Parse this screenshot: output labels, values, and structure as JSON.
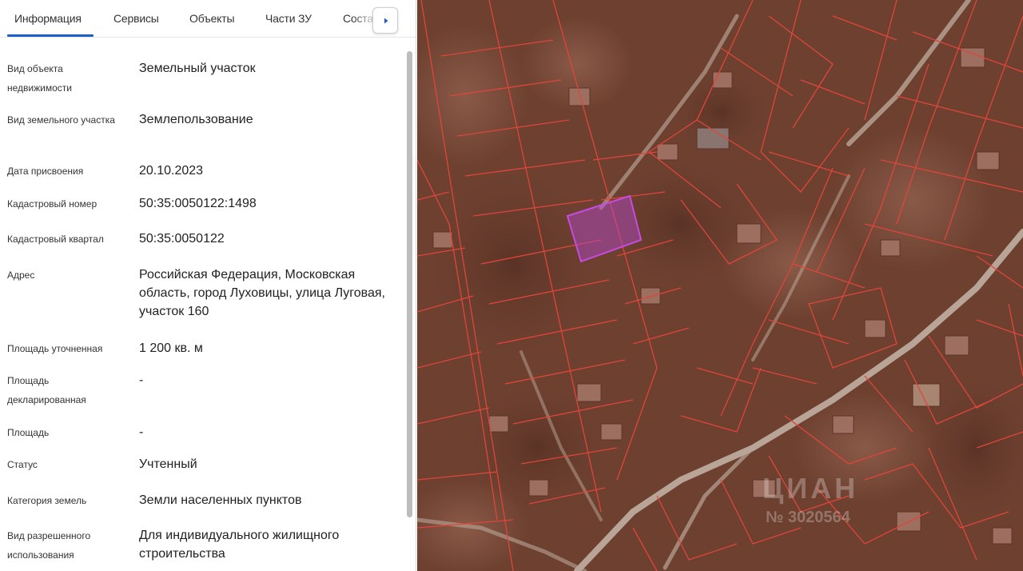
{
  "tabs": [
    {
      "label": "Информация",
      "active": true
    },
    {
      "label": "Сервисы",
      "active": false
    },
    {
      "label": "Объекты",
      "active": false
    },
    {
      "label": "Части ЗУ",
      "active": false
    },
    {
      "label": "Соста",
      "active": false
    }
  ],
  "fields": [
    {
      "label": "Вид объекта недвижимости",
      "value": "Земельный участок"
    },
    {
      "label": "Вид земельного участка",
      "value": "Землепользование"
    },
    {
      "label": "Дата присвоения",
      "value": "20.10.2023"
    },
    {
      "label": "Кадастровый номер",
      "value": "50:35:0050122:1498"
    },
    {
      "label": "Кадастровый квартал",
      "value": "50:35:0050122"
    },
    {
      "label": "Адрес",
      "value": "Российская Федерация, Московская область, город Луховицы, улица Луговая, участок 160"
    },
    {
      "label": "Площадь уточненная",
      "value": "1 200 кв. м"
    },
    {
      "label": "Площадь декларированная",
      "value": "-"
    },
    {
      "label": "Площадь",
      "value": "-"
    },
    {
      "label": "Статус",
      "value": "Учтенный"
    },
    {
      "label": "Категория земель",
      "value": "Земли населенных пунктов"
    },
    {
      "label": "Вид разрешенного использования",
      "value": "Для индивидуального жилищного строительства"
    }
  ],
  "map": {
    "watermark_brand": "ЦИАН",
    "watermark_id": "№ 3020564",
    "colors": {
      "parcel_border": "#e0453a",
      "selected_parcel": "#b64ad0",
      "terrain": "#6b3e2e",
      "road": "#b9a597"
    }
  },
  "icons": {
    "scroll_right": "chevron-right-icon"
  }
}
